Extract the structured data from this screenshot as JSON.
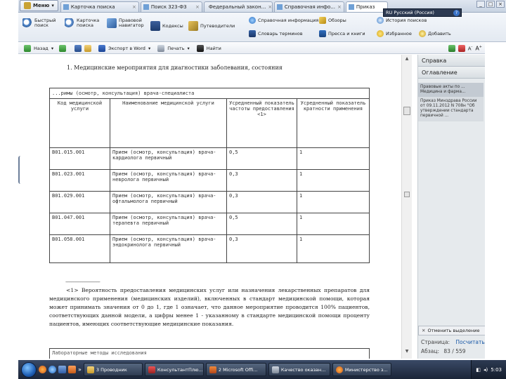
{
  "menu_button": "Меню",
  "tabs": [
    {
      "label": "Карточка поиска",
      "active": false
    },
    {
      "label": "Поиск 323-ФЗ",
      "active": false
    },
    {
      "label": "Федеральный закон...",
      "active": false
    },
    {
      "label": "Справочная инфо...",
      "active": false
    },
    {
      "label": "Приказ",
      "active": true
    }
  ],
  "language": "RU Русский (Россия)",
  "ribbon": {
    "quick_search": "Быстрый поиск",
    "card_search": "Карточка поиска",
    "legal_navigator": "Правовой навигатор",
    "codes": "Кодексы",
    "guides": "Путеводители",
    "reference_info": "Справочная информация",
    "reviews": "Обзоры",
    "search_history": "История поисков",
    "dictionary": "Словарь терминов",
    "press_books": "Пресса и книги",
    "favorites": "Избранное",
    "add": "Добавить"
  },
  "toolbar": {
    "back": "Назад",
    "export_word": "Экспорт в Word",
    "print": "Печать",
    "find": "Найти"
  },
  "document": {
    "heading": "1. Медицинские мероприятия для диагностики заболевания, состояния",
    "table_caption": "...римы (осмотр, консультация) врача-специалиста",
    "columns": [
      "Код медицинской услуги",
      "Наименование медицинской услуги",
      "Усредненный показатель частоты предоставления <1>",
      "Усредненный показатель кратности применения"
    ],
    "rows": [
      {
        "code": "B01.015.001",
        "name": "Прием (осмотр, консультация) врача-кардиолога первичный",
        "freq": "0,5",
        "mult": "1"
      },
      {
        "code": "B01.023.001",
        "name": "Прием (осмотр, консультация) врача-невролога первичный",
        "freq": "0,3",
        "mult": "1"
      },
      {
        "code": "B01.029.001",
        "name": "Прием (осмотр, консультация) врача-офтальмолога первичный",
        "freq": "0,3",
        "mult": "1"
      },
      {
        "code": "B01.047.001",
        "name": "Прием (осмотр, консультация) врача-терапевта первичный",
        "freq": "0,5",
        "mult": "1"
      },
      {
        "code": "B01.058.001",
        "name": "Прием (осмотр, консультация) врача-эндокринолога первичный",
        "freq": "0,3",
        "mult": "1"
      }
    ],
    "footnote_rule": "--------------------------------",
    "footnote": "<1> Вероятность предоставления медицинских услуг или назначения лекарственных препаратов для медицинского применения (медицинских изделий), включенных в стандарт медицинской помощи, которая может принимать значения от 0 до 1, где 1 означает, что данное мероприятие проводится 100% пациентов, соответствующих данной модели, а цифры менее 1 - указанному в стандарте медицинской помощи проценту пациентов, имеющих соответствующие медицинские показания.",
    "next_table_caption": "Лабораторные методы исследования"
  },
  "panel": {
    "help": "Справка",
    "contents": "Оглавление",
    "related_header": "Правовые акты по ... Медицина и фарма...",
    "related_text": "Приказ Минздрава России от 09.11.2012 N 708н \"Об утверждении стандарта первичной ...",
    "mark_button": "Отменить выделение",
    "page_label": "Страница:",
    "print_link": "Посчитать",
    "paragraph_label": "Абзац:",
    "paragraph_value": "83 / 559"
  },
  "taskbar": {
    "items": [
      "3 Проводник",
      "КонсультантПлю...",
      "2 Microsoft Offi...",
      "Качество оказан...",
      "Министерство з..."
    ],
    "clock": "5:03"
  },
  "colors": {
    "taskbar": "#1b2538",
    "panel": "#e6eaed",
    "link": "#1b5aa8"
  }
}
